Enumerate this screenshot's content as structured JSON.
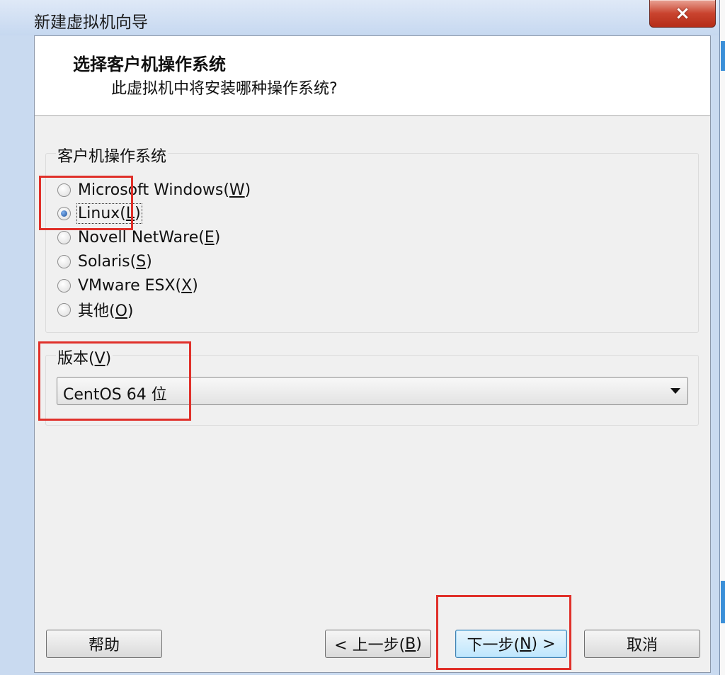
{
  "window": {
    "title": "新建虚拟机向导",
    "close_symbol": "×"
  },
  "header": {
    "title": "选择客户机操作系统",
    "subtitle": "此虚拟机中将安装哪种操作系统?"
  },
  "guest_os": {
    "group_label": "客户机操作系统",
    "options": [
      {
        "pre": "Microsoft Windows(",
        "key": "W",
        "post": ")",
        "checked": false
      },
      {
        "pre": "Linux(",
        "key": "L",
        "post": ")",
        "checked": true
      },
      {
        "pre": "Novell NetWare(",
        "key": "E",
        "post": ")",
        "checked": false
      },
      {
        "pre": "Solaris(",
        "key": "S",
        "post": ")",
        "checked": false
      },
      {
        "pre": "VMware ESX(",
        "key": "X",
        "post": ")",
        "checked": false
      },
      {
        "pre": "其他(",
        "key": "O",
        "post": ")",
        "checked": false
      }
    ]
  },
  "version": {
    "label_pre": "版本(",
    "label_key": "V",
    "label_post": ")",
    "selected": "CentOS 64 位"
  },
  "buttons": {
    "help": "帮助",
    "back_pre": "< 上一步(",
    "back_key": "B",
    "back_post": ")",
    "next_pre": "下一步(",
    "next_key": "N",
    "next_post": ") >",
    "cancel": "取消"
  },
  "colors": {
    "annotation_red": "#e0302a",
    "window_frame": "#c9daf0",
    "close_button": "#c9432e",
    "default_button": "#bee6fd"
  }
}
